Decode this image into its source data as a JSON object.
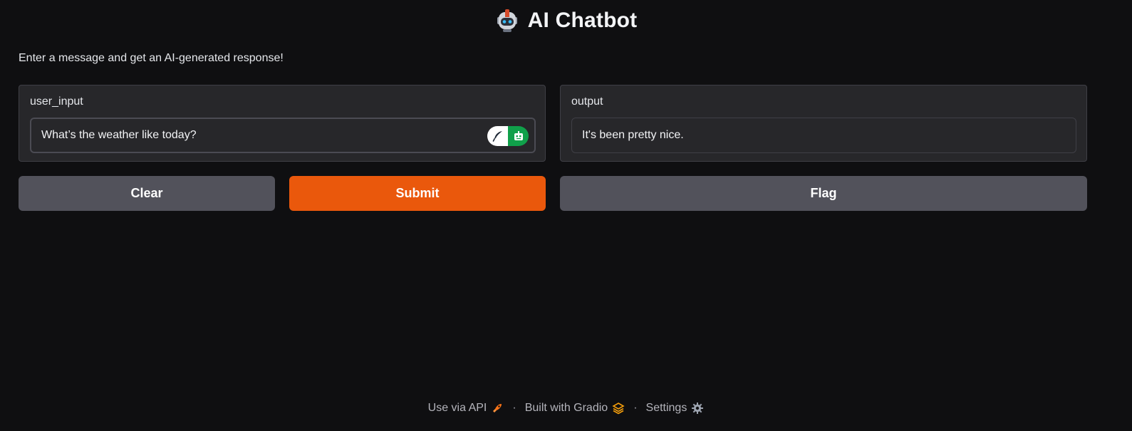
{
  "header": {
    "title": "AI Chatbot",
    "icon": "robot-icon"
  },
  "description": "Enter a message and get an AI-generated response!",
  "input_panel": {
    "label": "user_input",
    "value": "What’s the weather like today?",
    "extension_icons": [
      "quill-icon",
      "bot-icon"
    ]
  },
  "output_panel": {
    "label": "output",
    "value": "It's been pretty nice."
  },
  "buttons": {
    "clear": "Clear",
    "submit": "Submit",
    "flag": "Flag"
  },
  "footer": {
    "api": "Use via API",
    "built": "Built with Gradio",
    "settings": "Settings",
    "separator": "·"
  },
  "colors": {
    "background": "#0f0f11",
    "panel": "#27272a",
    "primary_button": "#ea580c",
    "secondary_button": "#52525b",
    "gradio_accent": "#f59e0b"
  }
}
